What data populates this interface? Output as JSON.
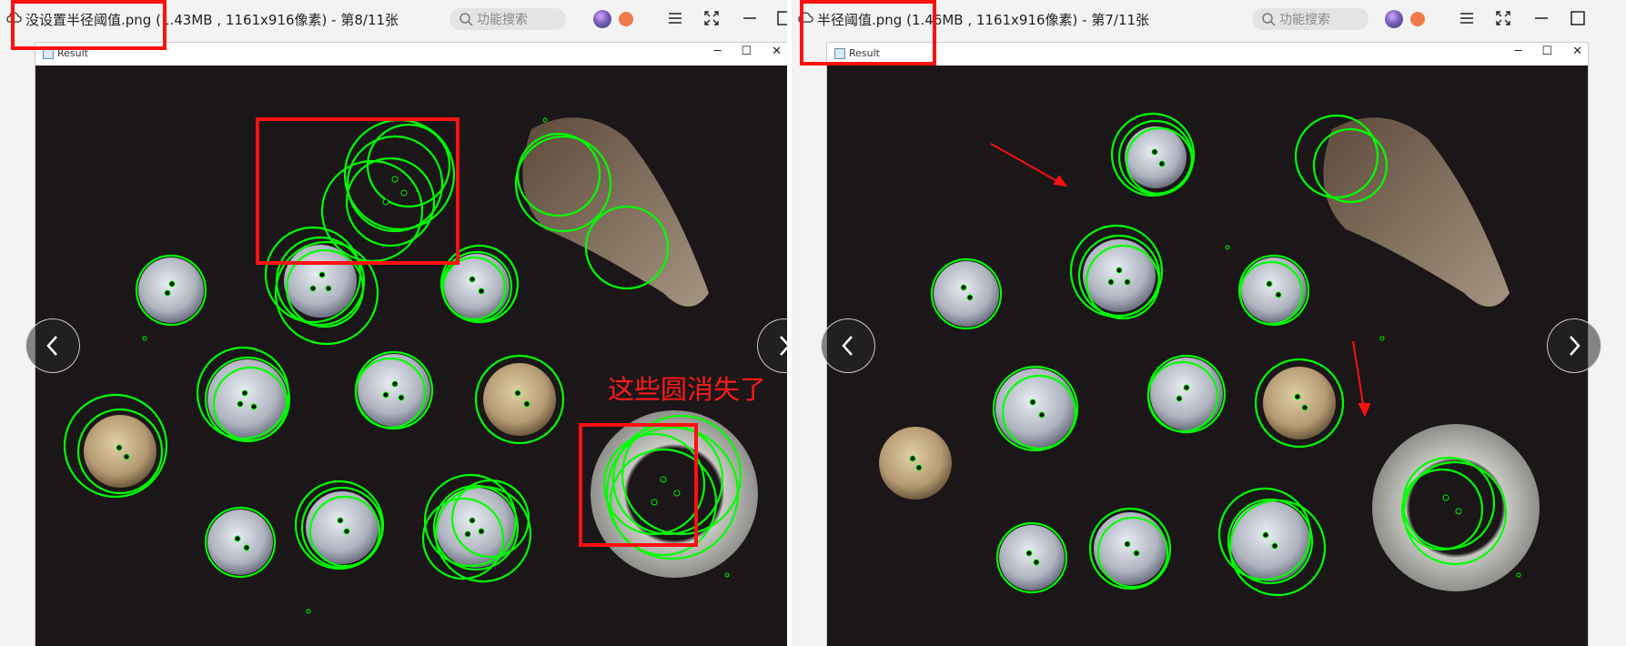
{
  "viewers": [
    {
      "id": "left",
      "title": "没设置半径阈值.png (1.43MB , 1161x916像素) - 第8/11张",
      "search_placeholder": "功能搜索",
      "inner_window_title": "Result",
      "annotation": "这些圆消失了"
    },
    {
      "id": "right",
      "title": "半径阈值.png (1.46MB , 1161x916像素) - 第7/11张",
      "search_placeholder": "功能搜索",
      "inner_window_title": "Result"
    }
  ],
  "icons": {
    "cloud": "cloud-icon",
    "search": "search-icon",
    "menu": "hamburger-menu-icon",
    "fullscreen": "fullscreen-icon",
    "minimize": "minimize-icon",
    "maximize": "maximize-icon",
    "prev": "chevron-left-icon",
    "next": "chevron-right-icon"
  },
  "colors": {
    "circle_stroke": "#00ff00",
    "annotation_red": "#ff1010",
    "photo_background": "#1b1617"
  },
  "inner_window_controls": [
    "─",
    "☐",
    "✕"
  ]
}
